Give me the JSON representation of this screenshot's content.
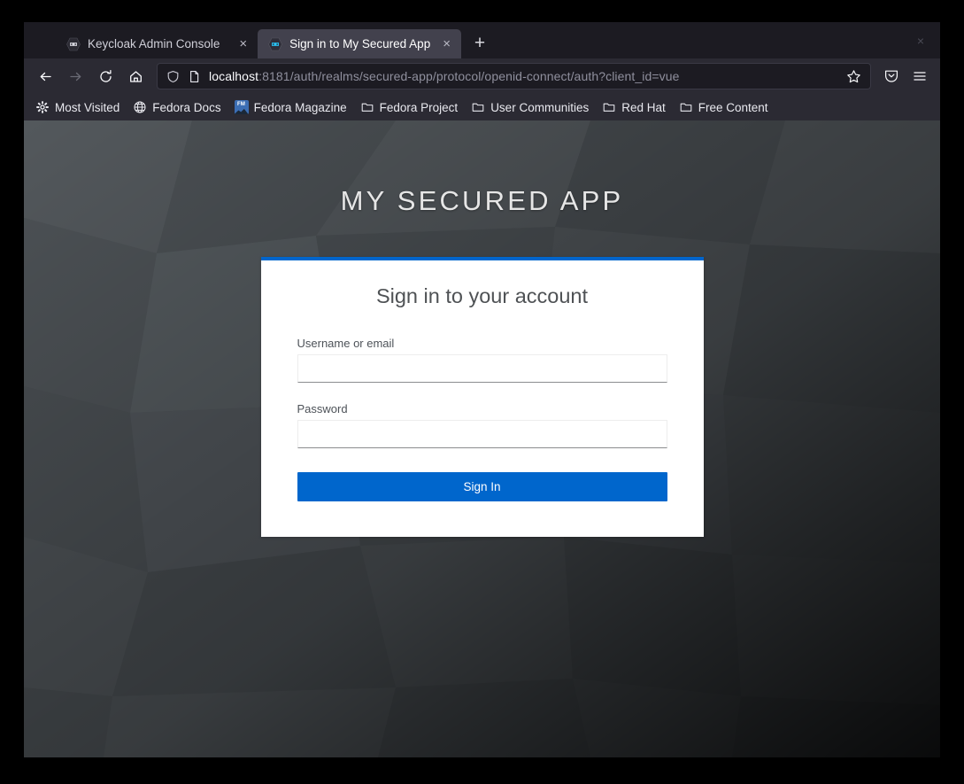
{
  "browser": {
    "tabs": [
      {
        "title": "Keycloak Admin Console",
        "favicon": "keycloak-icon",
        "close_label": "×",
        "active": false
      },
      {
        "title": "Sign in to My Secured App",
        "favicon": "keycloak-icon",
        "close_label": "×",
        "active": true
      }
    ],
    "new_tab_label": "+",
    "window_close_label": "×",
    "nav": {
      "back_label": "back-icon",
      "forward_label": "forward-icon",
      "reload_label": "reload-icon",
      "home_label": "home-icon"
    },
    "url": {
      "host": "localhost",
      "path": ":8181/auth/realms/secured-app/protocol/openid-connect/auth?client_id=vue",
      "full": "localhost:8181/auth/realms/secured-app/protocol/openid-connect/auth?client_id=vue",
      "shield_icon": "shield-icon",
      "page_icon": "page-icon",
      "star_icon": "star-icon"
    },
    "toolbar": {
      "pocket_icon": "pocket-icon",
      "menu_icon": "hamburger-menu-icon"
    },
    "bookmarks": [
      {
        "label": "Most Visited",
        "icon": "gear-icon"
      },
      {
        "label": "Fedora Docs",
        "icon": "globe-icon"
      },
      {
        "label": "Fedora Magazine",
        "icon": "fedora-magazine-icon"
      },
      {
        "label": "Fedora Project",
        "icon": "folder-icon"
      },
      {
        "label": "User Communities",
        "icon": "folder-icon"
      },
      {
        "label": "Red Hat",
        "icon": "folder-icon"
      },
      {
        "label": "Free Content",
        "icon": "folder-icon"
      }
    ]
  },
  "page": {
    "app_title": "MY SECURED APP",
    "card": {
      "heading": "Sign in to your account",
      "username": {
        "label": "Username or email",
        "value": "",
        "placeholder": ""
      },
      "password": {
        "label": "Password",
        "value": "",
        "placeholder": ""
      },
      "submit_label": "Sign In"
    }
  },
  "colors": {
    "accent_blue": "#0066cc",
    "card_background": "#ffffff",
    "page_background": "#393f44",
    "chrome_background": "#2b2a33",
    "tab_strip_background": "#1c1b22",
    "active_tab_background": "#42414d"
  }
}
